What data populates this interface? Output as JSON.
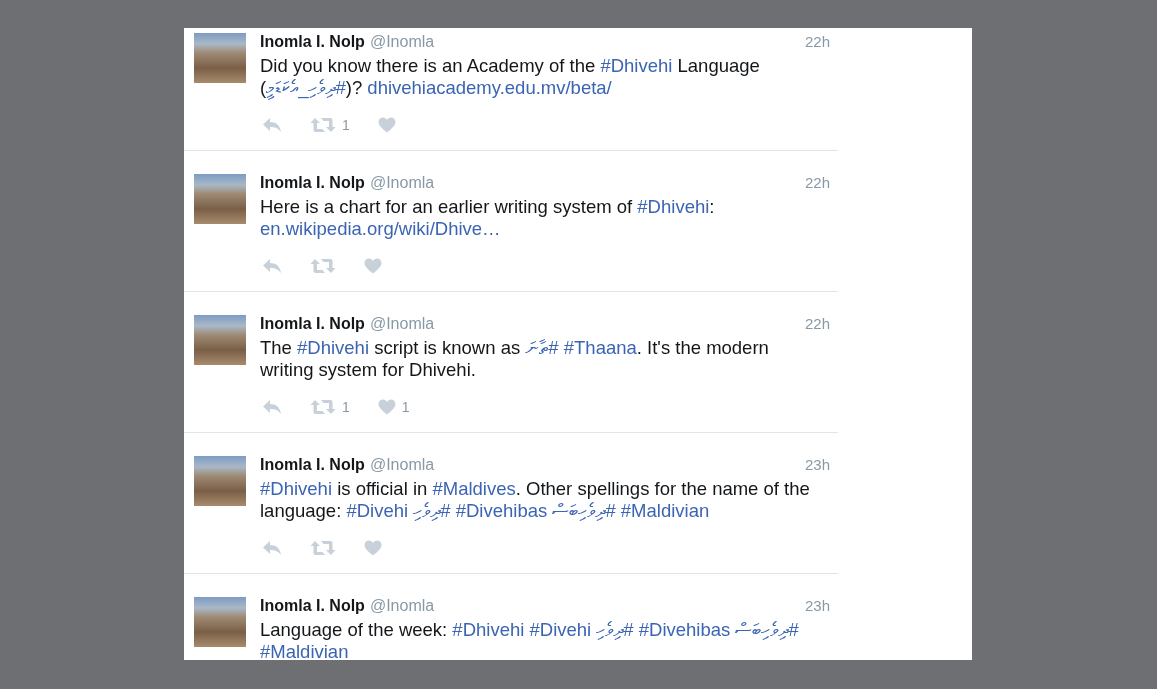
{
  "tweets": [
    {
      "kind": "full",
      "author": "Inomla I. Nolp",
      "handle": "@Inomla",
      "time": "22h",
      "body": [
        {
          "kind": "text",
          "text": "Did you know there is an Academy of the "
        },
        {
          "kind": "hashtag",
          "text": "#Dhivehi"
        },
        {
          "kind": "text",
          "text": " Language ("
        },
        {
          "kind": "hashtag",
          "text": "#ދިވެހި_އެކަޑަމީ"
        },
        {
          "kind": "text",
          "text": ")? "
        },
        {
          "kind": "url",
          "text": "dhivehiacademy.edu.mv/beta/"
        }
      ],
      "retweets": "1"
    },
    {
      "kind": "full",
      "author": "Inomla I. Nolp",
      "handle": "@Inomla",
      "time": "22h",
      "body": [
        {
          "kind": "text",
          "text": "Here is a chart for an earlier writing system of "
        },
        {
          "kind": "hashtag",
          "text": "#Dhivehi"
        },
        {
          "kind": "text",
          "text": ": "
        },
        {
          "kind": "url",
          "text": "en.wikipedia.org/wiki/Dhive…"
        }
      ]
    },
    {
      "kind": "full",
      "author": "Inomla I. Nolp",
      "handle": "@Inomla",
      "time": "22h",
      "body": [
        {
          "kind": "text",
          "text": "The "
        },
        {
          "kind": "hashtag",
          "text": "#Dhivehi"
        },
        {
          "kind": "text",
          "text": " script is known as "
        },
        {
          "kind": "hashtag",
          "text": "#ތާނަ"
        },
        {
          "kind": "hashtag",
          "text": "#Thaana"
        },
        {
          "kind": "text",
          "text": ". It's the modern writing system for Dhivehi."
        }
      ],
      "retweets": "1",
      "likes": "1"
    },
    {
      "kind": "full",
      "author": "Inomla I. Nolp",
      "handle": "@Inomla",
      "time": "23h",
      "body": [
        {
          "kind": "hashtag",
          "text": "#Dhivehi"
        },
        {
          "kind": "text",
          "text": " is official in "
        },
        {
          "kind": "hashtag",
          "text": "#Maldives"
        },
        {
          "kind": "text",
          "text": ". Other spellings for the name of the language: "
        },
        {
          "kind": "hashtag",
          "text": "#Divehi"
        },
        {
          "kind": "hashtag",
          "text": "#ދިވެހި"
        },
        {
          "kind": "hashtag",
          "text": "#Divehibas"
        },
        {
          "kind": "hashtag",
          "text": "#ދިވެހިބަސް"
        },
        {
          "kind": "hashtag",
          "text": "#Maldivian"
        }
      ]
    },
    {
      "kind": "clipped",
      "author": "Inomla I. Nolp",
      "handle": "@Inomla",
      "time": "23h",
      "body": [
        {
          "kind": "text",
          "text": "Language of the week: "
        },
        {
          "kind": "hashtag",
          "text": "#Dhivehi"
        },
        {
          "kind": "hashtag",
          "text": "#Divehi"
        },
        {
          "kind": "hashtag",
          "text": "#ދިވެހި"
        },
        {
          "kind": "hashtag",
          "text": "#Divehibas"
        },
        {
          "kind": "hashtag",
          "text": "#ދިވެހިބަސް"
        },
        {
          "kind": "hashtag",
          "text": "#Maldivian"
        }
      ]
    }
  ]
}
